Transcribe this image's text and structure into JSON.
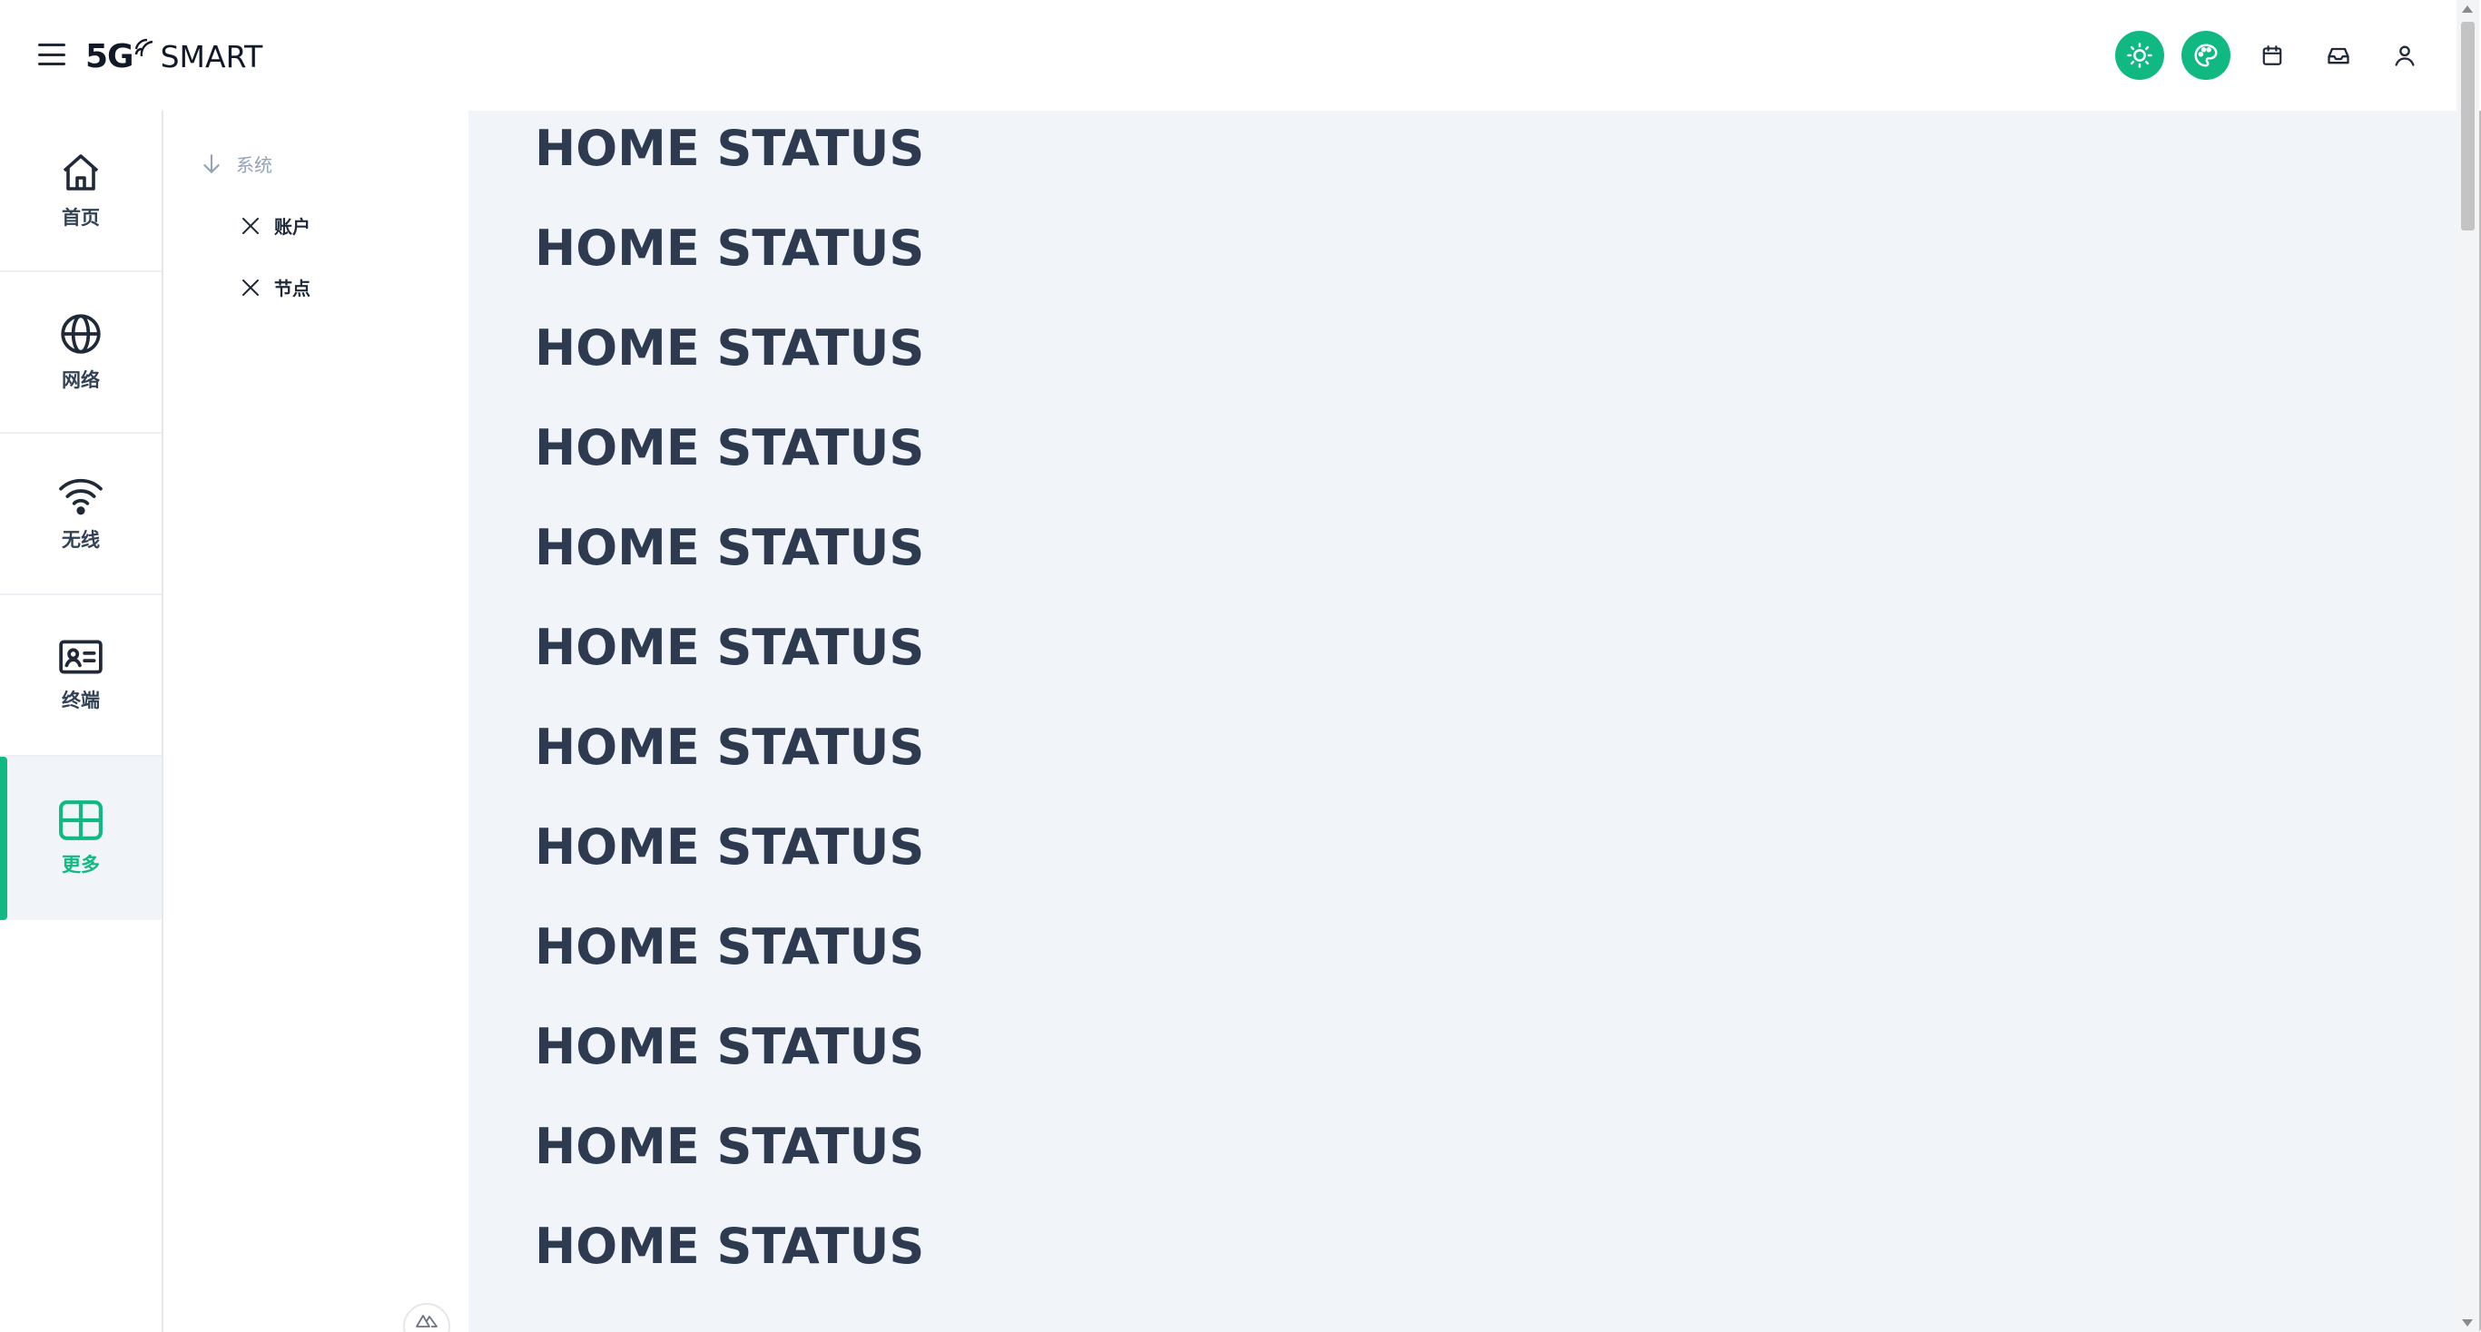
{
  "app": {
    "brand_badge": "5G",
    "brand_name": "SMART"
  },
  "header": {
    "icons": [
      "sun-icon",
      "palette-icon",
      "calendar-icon",
      "inbox-icon",
      "user-icon"
    ],
    "accent_color": "#10b981"
  },
  "nav": {
    "items": [
      {
        "label": "首页",
        "icon": "home-icon"
      },
      {
        "label": "网络",
        "icon": "globe-icon"
      },
      {
        "label": "无线",
        "icon": "wifi-icon"
      },
      {
        "label": "终端",
        "icon": "id-card-icon"
      },
      {
        "label": "更多",
        "icon": "grid-icon",
        "active": true
      }
    ]
  },
  "submenu": {
    "group_label": "系统",
    "items": [
      {
        "label": "账户"
      },
      {
        "label": "节点"
      }
    ]
  },
  "main": {
    "lines": [
      "HOME STATUS",
      "HOME STATUS",
      "HOME STATUS",
      "HOME STATUS",
      "HOME STATUS",
      "HOME STATUS",
      "HOME STATUS",
      "HOME STATUS",
      "HOME STATUS",
      "HOME STATUS",
      "HOME STATUS",
      "HOME STATUS"
    ]
  }
}
